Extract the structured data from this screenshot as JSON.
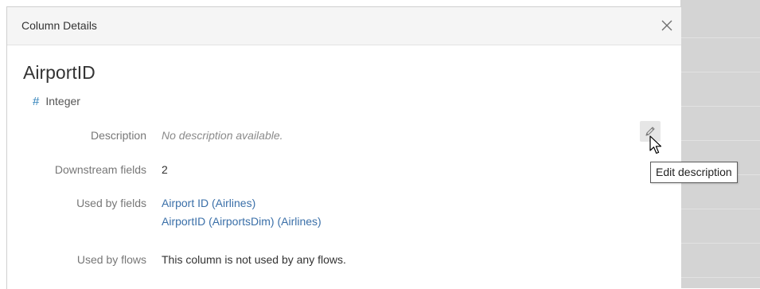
{
  "panel": {
    "header_title": "Column Details",
    "close_icon": "close-icon"
  },
  "column": {
    "name": "AirportID",
    "type_glyph": "#",
    "type": "Integer"
  },
  "details": {
    "description_label": "Description",
    "description_value": "No description available.",
    "downstream_label": "Downstream fields",
    "downstream_value": "2",
    "used_by_fields_label": "Used by fields",
    "used_by_fields": [
      "Airport ID (Airlines)",
      "AirportID (AirportsDim) (Airlines)"
    ],
    "used_by_flows_label": "Used by flows",
    "used_by_flows_value": "This column is not used by any flows."
  },
  "edit": {
    "icon": "pencil-icon",
    "tooltip": "Edit description"
  },
  "colors": {
    "link": "#3a6fa8",
    "type_glyph": "#2c7fb8",
    "header_bg": "#f5f5f5",
    "backdrop": "#d4d4d4"
  }
}
